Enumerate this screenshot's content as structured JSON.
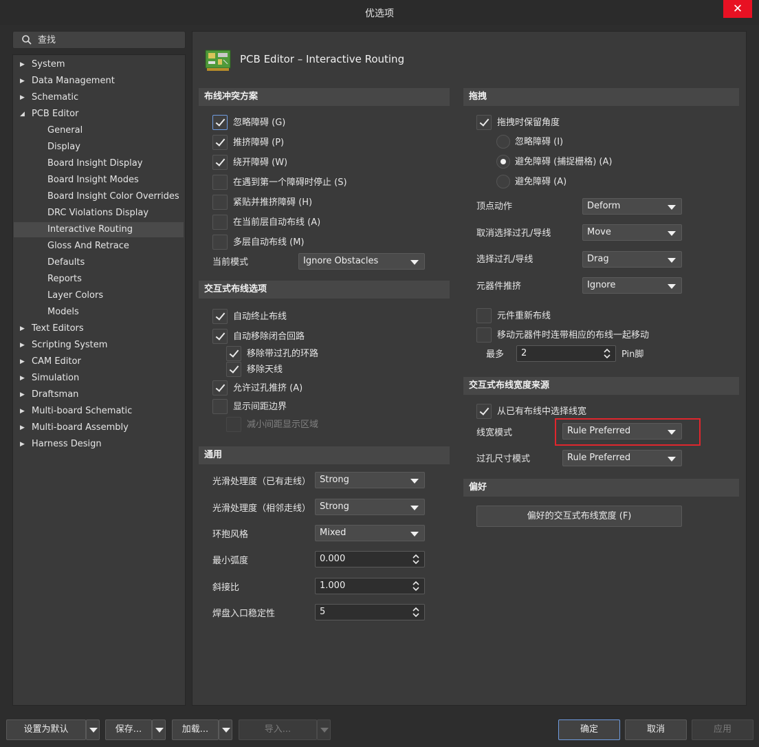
{
  "window": {
    "title": "优选项",
    "close_symbol": "✕"
  },
  "search": {
    "placeholder": "查找"
  },
  "nav": {
    "items": [
      {
        "label": "System",
        "expanded": false
      },
      {
        "label": "Data Management",
        "expanded": false
      },
      {
        "label": "Schematic",
        "expanded": false
      },
      {
        "label": "PCB Editor",
        "expanded": true
      },
      {
        "label": "General"
      },
      {
        "label": "Display"
      },
      {
        "label": "Board Insight Display"
      },
      {
        "label": "Board Insight Modes"
      },
      {
        "label": "Board Insight Color Overrides"
      },
      {
        "label": "DRC Violations Display"
      },
      {
        "label": "Interactive Routing",
        "selected": true
      },
      {
        "label": "Gloss And Retrace"
      },
      {
        "label": "Defaults"
      },
      {
        "label": "Reports"
      },
      {
        "label": "Layer Colors"
      },
      {
        "label": "Models"
      },
      {
        "label": "Text Editors",
        "expanded": false
      },
      {
        "label": "Scripting System",
        "expanded": false
      },
      {
        "label": "CAM Editor",
        "expanded": false
      },
      {
        "label": "Simulation",
        "expanded": false
      },
      {
        "label": "Draftsman",
        "expanded": false
      },
      {
        "label": "Multi-board Schematic",
        "expanded": false
      },
      {
        "label": "Multi-board Assembly",
        "expanded": false
      },
      {
        "label": "Harness Design",
        "expanded": false
      }
    ]
  },
  "page": {
    "title": "PCB Editor – Interactive Routing"
  },
  "conflict": {
    "header": "布线冲突方案",
    "options": [
      {
        "label": "忽略障碍 (G)",
        "checked": true
      },
      {
        "label": "推挤障碍 (P)",
        "checked": true
      },
      {
        "label": "绕开障碍 (W)",
        "checked": true
      },
      {
        "label": "在遇到第一个障碍时停止 (S)",
        "checked": false
      },
      {
        "label": "紧贴并推挤障碍 (H)",
        "checked": false
      },
      {
        "label": "在当前层自动布线 (A)",
        "checked": false
      },
      {
        "label": "多层自动布线 (M)",
        "checked": false
      }
    ],
    "mode_label": "当前模式",
    "mode_value": "Ignore Obstacles"
  },
  "interactive": {
    "header": "交互式布线选项",
    "auto_terminate": "自动终止布线",
    "auto_remove_loops": "自动移除闭合回路",
    "remove_via_loops": "移除带过孔的环路",
    "remove_antennas": "移除天线",
    "allow_via_push": "允许过孔推挤 (A)",
    "show_clearance": "显示间距边界",
    "reduce_clearance": "减小间距显示区域"
  },
  "general": {
    "header": "通用",
    "smooth_existing_label": "光滑处理度（已有走线）",
    "smooth_existing_value": "Strong",
    "smooth_adjacent_label": "光滑处理度（相邻走线）",
    "smooth_adjacent_value": "Strong",
    "hug_style_label": "环抱风格",
    "hug_style_value": "Mixed",
    "min_arc_label": "最小弧度",
    "min_arc_value": "0.000",
    "miter_label": "斜接比",
    "miter_value": "1.000",
    "pad_entry_label": "焊盘入口稳定性",
    "pad_entry_value": "5"
  },
  "drag": {
    "header": "拖拽",
    "preserve_angle": "拖拽时保留角度",
    "radio_ignore": "忽略障碍 (I)",
    "radio_avoid_snap": "避免障碍 (捕捉栅格) (A)",
    "radio_avoid": "避免障碍 (A)",
    "vertex_label": "顶点动作",
    "vertex_value": "Deform",
    "unselected_label": "取消选择过孔/导线",
    "unselected_value": "Move",
    "selected_label": "选择过孔/导线",
    "selected_value": "Drag",
    "component_push_label": "元器件推挤",
    "component_push_value": "Ignore",
    "reroute_label": "元件重新布线",
    "move_with_label": "移动元器件时连带相应的布线一起移动",
    "max_label": "最多",
    "max_value": "2",
    "max_unit": "Pin脚"
  },
  "width_source": {
    "header": "交互式布线宽度来源",
    "pick_existing": "从已有布线中选择线宽",
    "width_mode_label": "线宽模式",
    "width_mode_value": "Rule Preferred",
    "via_mode_label": "过孔尺寸模式",
    "via_mode_value": "Rule Preferred"
  },
  "favorites": {
    "header": "偏好",
    "button_label": "偏好的交互式布线宽度 (F)"
  },
  "footer": {
    "set_default": "设置为默认",
    "save": "保存...",
    "load": "加载...",
    "import": "导入...",
    "ok": "确定",
    "cancel": "取消",
    "apply": "应用"
  },
  "colors": {
    "highlight": "#e0262d",
    "focus": "#6f9ce0",
    "close": "#e81123"
  }
}
